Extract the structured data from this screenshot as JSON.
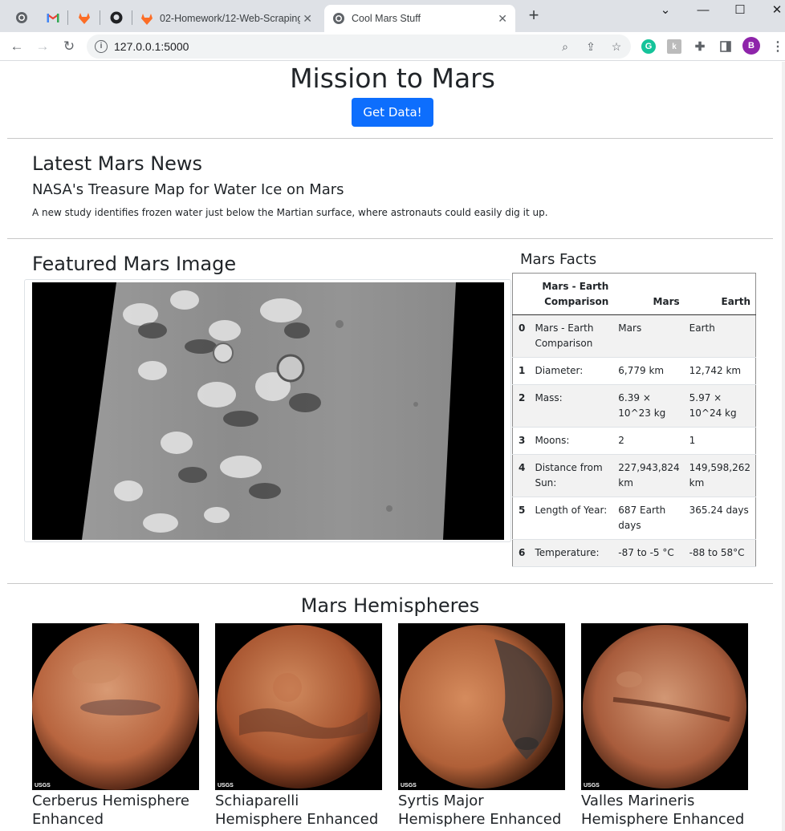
{
  "browser": {
    "tabs": [
      {
        "label": "02-Homework/12-Web-Scraping"
      },
      {
        "label": "Cool Mars Stuff"
      }
    ],
    "url": "127.0.0.1:5000",
    "profile_initial": "B"
  },
  "header": {
    "title": "Mission to Mars",
    "button_label": "Get Data!"
  },
  "news": {
    "section_title": "Latest Mars News",
    "headline": "NASA's Treasure Map for Water Ice on Mars",
    "teaser": "A new study identifies frozen water just below the Martian surface, where astronauts could easily dig it up."
  },
  "featured": {
    "section_title": "Featured Mars Image"
  },
  "facts": {
    "section_title": "Mars Facts",
    "headers": [
      "Mars - Earth Comparison",
      "Mars",
      "Earth"
    ],
    "rows": [
      {
        "idx": "0",
        "desc": "Mars - Earth Comparison",
        "mars": "Mars",
        "earth": "Earth"
      },
      {
        "idx": "1",
        "desc": "Diameter:",
        "mars": "6,779 km",
        "earth": "12,742 km"
      },
      {
        "idx": "2",
        "desc": "Mass:",
        "mars": "6.39 × 10^23 kg",
        "earth": "5.97 × 10^24 kg"
      },
      {
        "idx": "3",
        "desc": "Moons:",
        "mars": "2",
        "earth": "1"
      },
      {
        "idx": "4",
        "desc": "Distance from Sun:",
        "mars": "227,943,824 km",
        "earth": "149,598,262 km"
      },
      {
        "idx": "5",
        "desc": "Length of Year:",
        "mars": "687 Earth days",
        "earth": "365.24 days"
      },
      {
        "idx": "6",
        "desc": "Temperature:",
        "mars": "-87 to -5 °C",
        "earth": "-88 to 58°C"
      }
    ]
  },
  "hemispheres": {
    "section_title": "Mars Hemispheres",
    "items": [
      {
        "title": "Cerberus Hemisphere Enhanced",
        "badge": "USGS"
      },
      {
        "title": "Schiaparelli Hemisphere Enhanced",
        "badge": "USGS"
      },
      {
        "title": "Syrtis Major Hemisphere Enhanced",
        "badge": "USGS"
      },
      {
        "title": "Valles Marineris Hemisphere Enhanced",
        "badge": "USGS"
      }
    ]
  }
}
